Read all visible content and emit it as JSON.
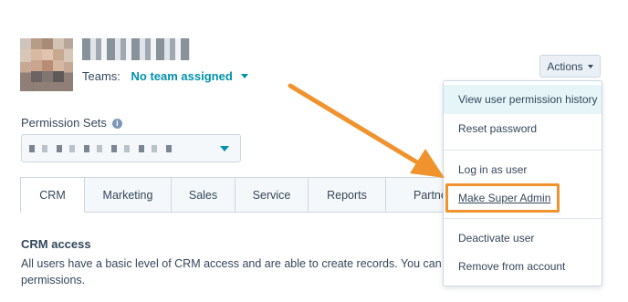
{
  "user": {
    "teams_label": "Teams:",
    "teams_value": "No team assigned"
  },
  "actions": {
    "label": "Actions"
  },
  "permission_sets": {
    "label": "Permission Sets"
  },
  "tabs": [
    {
      "label": "CRM"
    },
    {
      "label": "Marketing"
    },
    {
      "label": "Sales"
    },
    {
      "label": "Service"
    },
    {
      "label": "Reports"
    },
    {
      "label": "Partner p"
    }
  ],
  "content": {
    "title": "CRM access",
    "body_line1": "All users have a basic level of CRM access and are able to create records. You can manage the",
    "body_line2": "permissions."
  },
  "menu": {
    "items": [
      {
        "label": "View user permission history"
      },
      {
        "label": "Reset password"
      },
      {
        "label": "Log in as user"
      },
      {
        "label": "Make Super Admin"
      },
      {
        "label": "Deactivate user"
      },
      {
        "label": "Remove from account"
      }
    ]
  },
  "colors": {
    "accent": "#0091ae",
    "annotation": "#f0932e",
    "text": "#33475b",
    "menu_highlight": "#e5f5f8"
  }
}
